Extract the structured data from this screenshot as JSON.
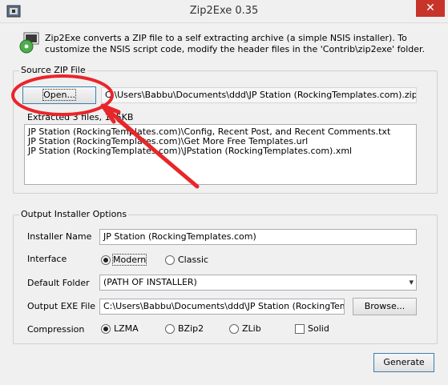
{
  "window": {
    "title": "Zip2Exe 0.35",
    "close_glyph": "✕"
  },
  "description": "Zip2Exe converts a ZIP file to a self extracting archive (a simple NSIS installer). To customize the NSIS script code, modify the header files in the 'Contrib\\zip2exe' folder.",
  "source": {
    "group_label": "Source ZIP File",
    "open_label": "Open...",
    "zip_path": "C:\\Users\\Babbu\\Documents\\ddd\\JP Station (RockingTemplates.com).zip",
    "extracted_text": "Extracted 3 files, 125KB",
    "files": [
      "JP Station (RockingTemplates.com)\\Config, Recent Post, and Recent Comments.txt",
      "JP Station (RockingTemplates.com)\\Get More Free Templates.url",
      "JP Station (RockingTemplates.com)\\JPstation (RockingTemplates.com).xml"
    ]
  },
  "output": {
    "group_label": "Output Installer Options",
    "installer_name_label": "Installer Name",
    "installer_name_value": "JP Station (RockingTemplates.com)",
    "interface_label": "Interface",
    "interface_options": [
      "Modern",
      "Classic"
    ],
    "interface_selected": "Modern",
    "default_folder_label": "Default Folder",
    "default_folder_value": "(PATH OF INSTALLER)",
    "output_exe_label": "Output EXE File",
    "output_exe_value": "C:\\Users\\Babbu\\Documents\\ddd\\JP Station (RockingTemplates",
    "browse_label": "Browse...",
    "compression_label": "Compression",
    "compression_options": [
      "LZMA",
      "BZip2",
      "ZLib"
    ],
    "compression_selected": "LZMA",
    "solid_label": "Solid",
    "solid_checked": false
  },
  "footer": {
    "generate_label": "Generate"
  },
  "colors": {
    "annotation": "#e8262a",
    "close_button": "#c7342a"
  }
}
